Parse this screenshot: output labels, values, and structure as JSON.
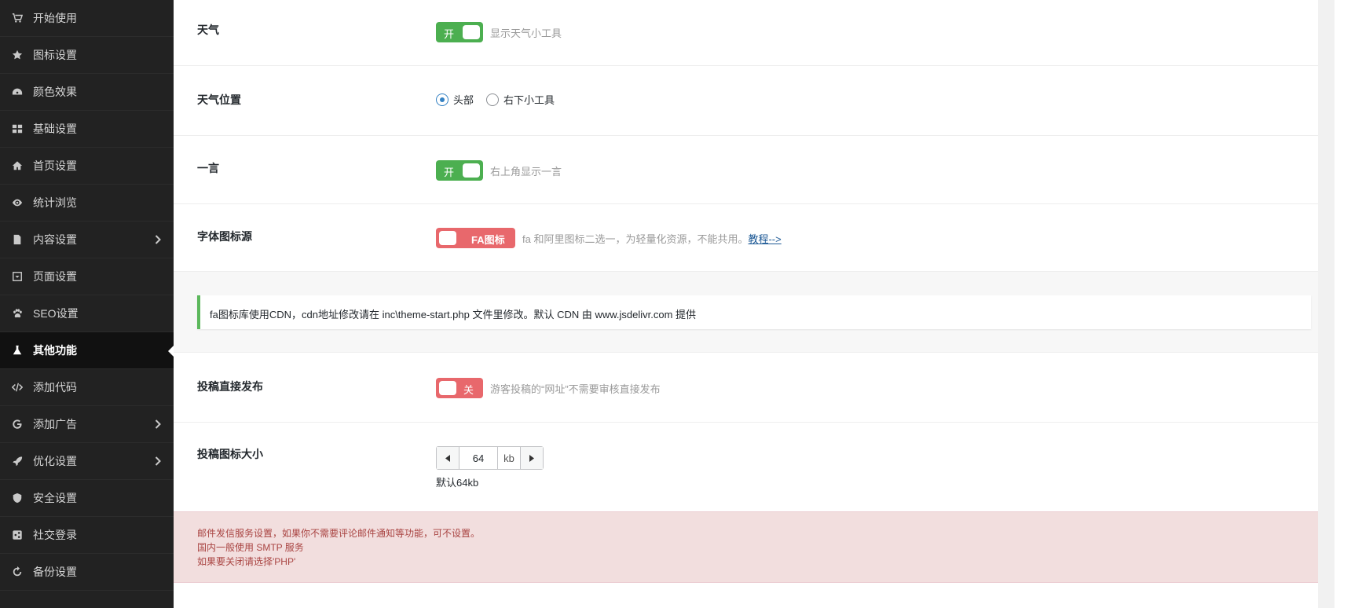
{
  "sidebar": {
    "items": [
      {
        "label": "开始使用",
        "icon": "cart-icon",
        "has_arrow": false,
        "active": false
      },
      {
        "label": "图标设置",
        "icon": "star-icon",
        "has_arrow": false,
        "active": false
      },
      {
        "label": "颜色效果",
        "icon": "dashboard-icon",
        "has_arrow": false,
        "active": false
      },
      {
        "label": "基础设置",
        "icon": "grid-icon",
        "has_arrow": false,
        "active": false
      },
      {
        "label": "首页设置",
        "icon": "home-icon",
        "has_arrow": false,
        "active": false
      },
      {
        "label": "统计浏览",
        "icon": "eye-icon",
        "has_arrow": false,
        "active": false
      },
      {
        "label": "内容设置",
        "icon": "file-icon",
        "has_arrow": true,
        "active": false
      },
      {
        "label": "页面设置",
        "icon": "page-box-icon",
        "has_arrow": false,
        "active": false
      },
      {
        "label": "SEO设置",
        "icon": "paw-icon",
        "has_arrow": false,
        "active": false
      },
      {
        "label": "其他功能",
        "icon": "flask-icon",
        "has_arrow": false,
        "active": true
      },
      {
        "label": "添加代码",
        "icon": "code-icon",
        "has_arrow": false,
        "active": false
      },
      {
        "label": "添加广告",
        "icon": "google-icon",
        "has_arrow": true,
        "active": false
      },
      {
        "label": "优化设置",
        "icon": "rocket-icon",
        "has_arrow": true,
        "active": false
      },
      {
        "label": "安全设置",
        "icon": "shield-icon",
        "has_arrow": false,
        "active": false
      },
      {
        "label": "社交登录",
        "icon": "share-icon",
        "has_arrow": false,
        "active": false
      },
      {
        "label": "备份设置",
        "icon": "backup-icon",
        "has_arrow": false,
        "active": false
      }
    ]
  },
  "settings": {
    "weather": {
      "title": "天气",
      "switch_label": "开",
      "desc": "显示天气小工具"
    },
    "weather_position": {
      "title": "天气位置",
      "options": [
        "头部",
        "右下小工具"
      ],
      "selected": "头部"
    },
    "hitokoto": {
      "title": "一言",
      "switch_label": "开",
      "desc": "右上角显示一言"
    },
    "font_icon_source": {
      "title": "字体图标源",
      "switch_label": "FA图标",
      "desc": "fa 和阿里图标二选一，为轻量化资源，不能共用。",
      "link_text": "教程-->"
    },
    "notice": "fa图标库使用CDN，cdn地址修改请在 inc\\theme-start.php 文件里修改。默认 CDN 由 www.jsdelivr.com 提供",
    "direct_publish": {
      "title": "投稿直接发布",
      "switch_label": "关",
      "desc": "游客投稿的“网址”不需要审核直接发布"
    },
    "icon_size": {
      "title": "投稿图标大小",
      "value": "64",
      "unit": "kb",
      "hint": "默认64kb"
    },
    "mail_notice": {
      "line1": "邮件发信服务设置，如果你不需要评论邮件通知等功能，可不设置。",
      "line2": "国内一般使用 SMTP 服务",
      "line3": "如果要关闭请选择'PHP'"
    }
  },
  "colors": {
    "sidebar_bg": "#222222",
    "switch_on": "#4caf50",
    "switch_off": "#e8686c",
    "notice_border": "#5cb85c",
    "danger_bg": "#f2dede",
    "danger_text": "#a94442"
  }
}
